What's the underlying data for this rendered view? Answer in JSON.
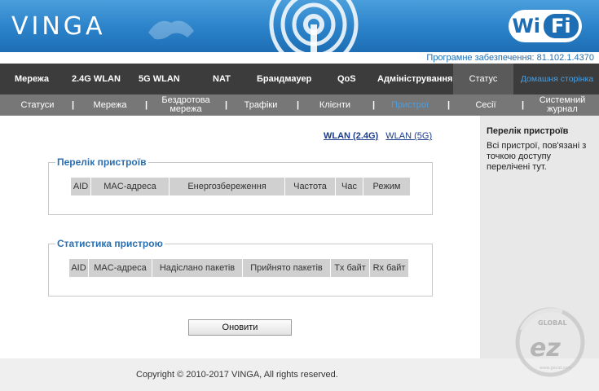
{
  "banner": {
    "logo": "VINGA",
    "badge_wi": "Wi",
    "badge_fi": "Fi",
    "version": "Програмне забезпечення: 81.102.1.4370"
  },
  "nav": [
    {
      "label": "Мережа"
    },
    {
      "label": "2.4G WLAN"
    },
    {
      "label": "5G WLAN"
    },
    {
      "label": "NAT"
    },
    {
      "label": "Брандмауер"
    },
    {
      "label": "QoS"
    },
    {
      "label": "Адміністрування"
    },
    {
      "label": "Статус"
    },
    {
      "label": "Домашня сторінка"
    }
  ],
  "subnav": [
    {
      "label": "Статуси"
    },
    {
      "label": "Мережа"
    },
    {
      "label": "Бездротова мережа"
    },
    {
      "label": "Трафіки"
    },
    {
      "label": "Клієнти"
    },
    {
      "label": "Пристрої"
    },
    {
      "label": "Сесії"
    },
    {
      "label": "Системний журнал"
    }
  ],
  "separator": "|",
  "bands": {
    "wlan24": "WLAN (2.4G)",
    "wlan5": "WLAN (5G)"
  },
  "device_list": {
    "legend": "Перелік пристроїв",
    "columns": [
      "AID",
      "MAC-адреса",
      "Енергозбереження",
      "Частота",
      "Час",
      "Режим"
    ]
  },
  "device_stats": {
    "legend": "Статистика пристрою",
    "columns": [
      "AID",
      "MAC-адреса",
      "Надіслано пакетів",
      "Прийнято пакетів",
      "Tx байт",
      "Rx байт"
    ]
  },
  "refresh_button": "Оновити",
  "help": {
    "title": "Перелік пристроїв",
    "text": "Всі пристрої, пов'язані з точкою доступу перелічені тут."
  },
  "footer": {
    "copyright": "Copyright © 2010-2017 VINGA, All rights reserved."
  },
  "watermark": {
    "top": "GLOBAL",
    "brand": "ez",
    "site": "www.gecid.com"
  },
  "colors": {
    "banner": "#2b82c9",
    "nav_bg": "#3c3c3c",
    "subnav_bg": "#777777",
    "active_link": "#4a9ee0",
    "legend": "#2a6fb0"
  }
}
